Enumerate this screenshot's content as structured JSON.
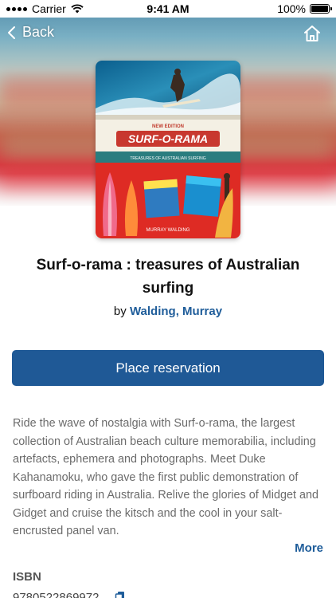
{
  "status_bar": {
    "carrier": "Carrier",
    "time": "9:41 AM",
    "battery": "100%",
    "battery_level": 1.0
  },
  "nav": {
    "back_label": "Back"
  },
  "cover": {
    "edition": "NEW EDITION",
    "wordmark": "SURF-O-RAMA",
    "subtitle": "TREASURES OF AUSTRALIAN SURFING",
    "author": "MURRAY WALDING"
  },
  "book": {
    "title": "Surf-o-rama : treasures of Australian surfing",
    "by_prefix": "by",
    "author": "Walding, Murray"
  },
  "actions": {
    "reserve_label": "Place reservation",
    "more_label": "More"
  },
  "description": "Ride the wave of nostalgia with Surf-o-rama, the largest collection of Australian beach culture memorabilia, including artefacts, ephemera and photographs. Meet Duke Kahanamoku, who gave the first public demonstration of surfboard riding in Australia. Relive the glories of Midget and Gidget and cruise the kitsch and the cool in your salt-encrusted panel van.",
  "details": {
    "isbn_label": "ISBN",
    "isbn_value": "9780522869972"
  },
  "colors": {
    "accent": "#1f5996",
    "link": "#1f5d9a"
  }
}
